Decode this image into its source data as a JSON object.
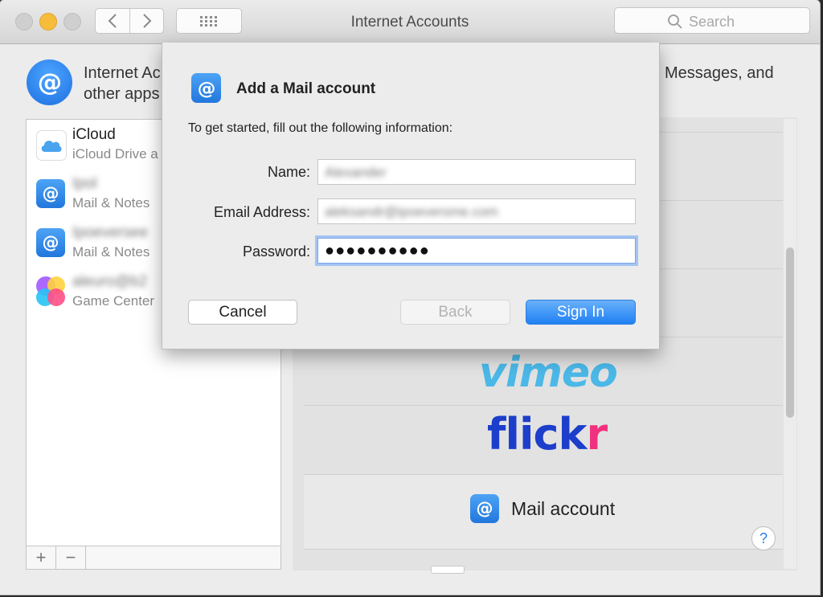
{
  "window": {
    "title": "Internet Accounts",
    "search_placeholder": "Search"
  },
  "header": {
    "description_start": "Internet Ac",
    "description_line2": "other apps",
    "description_end": "Messages, and"
  },
  "sidebar": {
    "accounts": [
      {
        "title": "iCloud",
        "subtitle": "iCloud Drive a",
        "icon": "icloud-icon",
        "blurred": false
      },
      {
        "title": "Ipol",
        "subtitle": "Mail & Notes",
        "icon": "mail-at-icon",
        "blurred": true
      },
      {
        "title": "Ipoeversee",
        "subtitle": "Mail & Notes",
        "icon": "mail-at-icon",
        "blurred": true
      },
      {
        "title": "aleuro@b2",
        "subtitle": "Game Center",
        "icon": "game-center-icon",
        "blurred": true
      }
    ],
    "add_label": "+",
    "remove_label": "−"
  },
  "providers": {
    "vimeo": "vimeo",
    "flickr_a": "flick",
    "flickr_b": "r",
    "mail_account": "Mail account"
  },
  "help_label": "?",
  "dialog": {
    "title": "Add a Mail account",
    "intro": "To get started, fill out the following information:",
    "name_label": "Name:",
    "name_value": "Alexander",
    "email_label": "Email Address:",
    "email_value": "aleksandr@ipoeversme.com",
    "password_label": "Password:",
    "password_value": "●●●●●●●●●●",
    "cancel_label": "Cancel",
    "back_label": "Back",
    "signin_label": "Sign In"
  },
  "colors": {
    "accent": "#1f80f3",
    "vimeo": "#4bb8e8",
    "flickr_blue": "#1c3ecb",
    "flickr_pink": "#f0317e"
  }
}
